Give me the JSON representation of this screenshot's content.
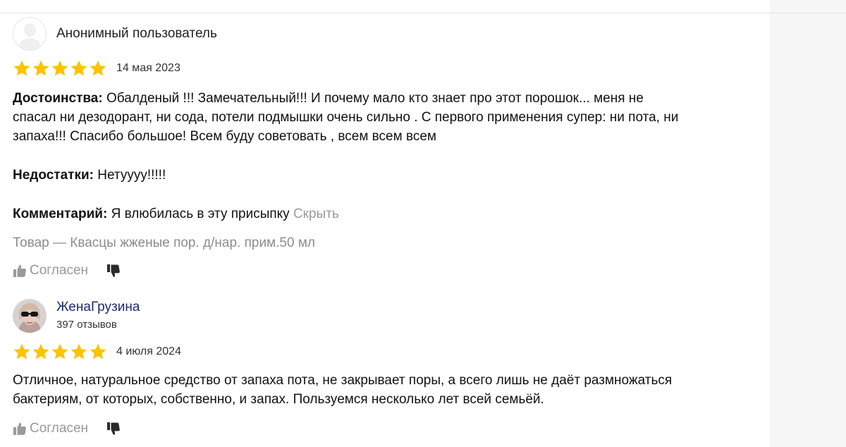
{
  "reviews": [
    {
      "author": "Анонимный пользователь",
      "date": "14 мая 2023",
      "rating": 5,
      "pros_label": "Достоинства:",
      "pros_line1": "Обалденый !!! Замечательный!!! И почему мало кто знает про этот порошок... меня не",
      "pros_line2": "спасал ни дезодорант, ни сода, потели подмышки очень сильно . С первого применения супер: ни пота, ни",
      "pros_line3": "запаха!!! Спасибо большое! Всем буду советовать , всем всем всем",
      "cons_label": "Недостатки:",
      "cons": "Нетуууу!!!!!",
      "comment_label": "Комментарий:",
      "comment": "Я влюбилась в эту присыпку",
      "hide": "Скрыть",
      "product": "Товар — Квасцы жженые пор. д/нар. прим.50 мл",
      "agree": "Согласен"
    },
    {
      "author": "ЖенаГрузина",
      "author_reviews": "397 отзывов",
      "date": "4 июля 2024",
      "rating": 5,
      "text_line1": "Отличное, натуральное средство от запаха пота, не закрывает поры, а всего лишь не даёт размножаться",
      "text_line2": "бактериям, от которых, собственно, и запах. Пользуемся несколько лет всей семьёй.",
      "agree": "Согласен"
    }
  ],
  "colors": {
    "star": "#fcc300",
    "muted": "#999999",
    "author_link": "#1e2a73"
  },
  "icons": [
    "user-avatar-icon",
    "star-icon",
    "thumbs-up-icon",
    "thumbs-down-icon"
  ]
}
